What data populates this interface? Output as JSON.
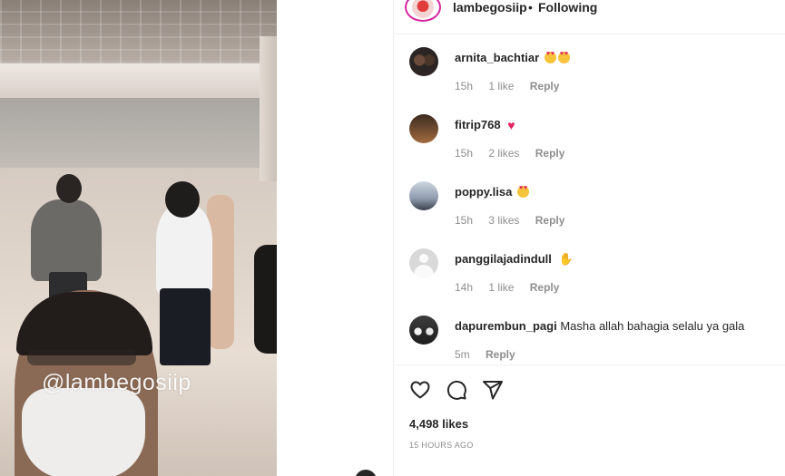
{
  "media": {
    "watermark": "@lambegosiip"
  },
  "header": {
    "username": "lambegosiip",
    "separator": "•",
    "follow_status": "Following"
  },
  "comments": [
    {
      "username": "arnita_bachtiar",
      "text": "",
      "emoji": [
        "heart-eyes",
        "heart-eyes"
      ],
      "time": "15h",
      "likes": "1 like",
      "reply": "Reply"
    },
    {
      "username": "fitrip768",
      "text": "",
      "emoji": [
        "red-heart"
      ],
      "time": "15h",
      "likes": "2 likes",
      "reply": "Reply"
    },
    {
      "username": "poppy.lisa",
      "text": "",
      "emoji": [
        "heart-eyes"
      ],
      "time": "15h",
      "likes": "3 likes",
      "reply": "Reply"
    },
    {
      "username": "panggilajadindull",
      "text": "",
      "emoji": [
        "raising-hands"
      ],
      "time": "14h",
      "likes": "1 like",
      "reply": "Reply"
    },
    {
      "username": "dapurembun_pagi",
      "text": "Masha allah bahagia selalu ya gala",
      "emoji": [],
      "time": "5m",
      "likes": "",
      "reply": "Reply"
    }
  ],
  "actions": {
    "like_icon": "heart-outline-icon",
    "comment_icon": "comment-bubble-icon",
    "share_icon": "paper-plane-icon"
  },
  "likes_count": "4,498 likes",
  "posted_ago": "15 HOURS AGO",
  "colors": {
    "text": "#262626",
    "secondary": "#8e8e8e",
    "divider": "#efefef",
    "heart": "#e0245e"
  }
}
